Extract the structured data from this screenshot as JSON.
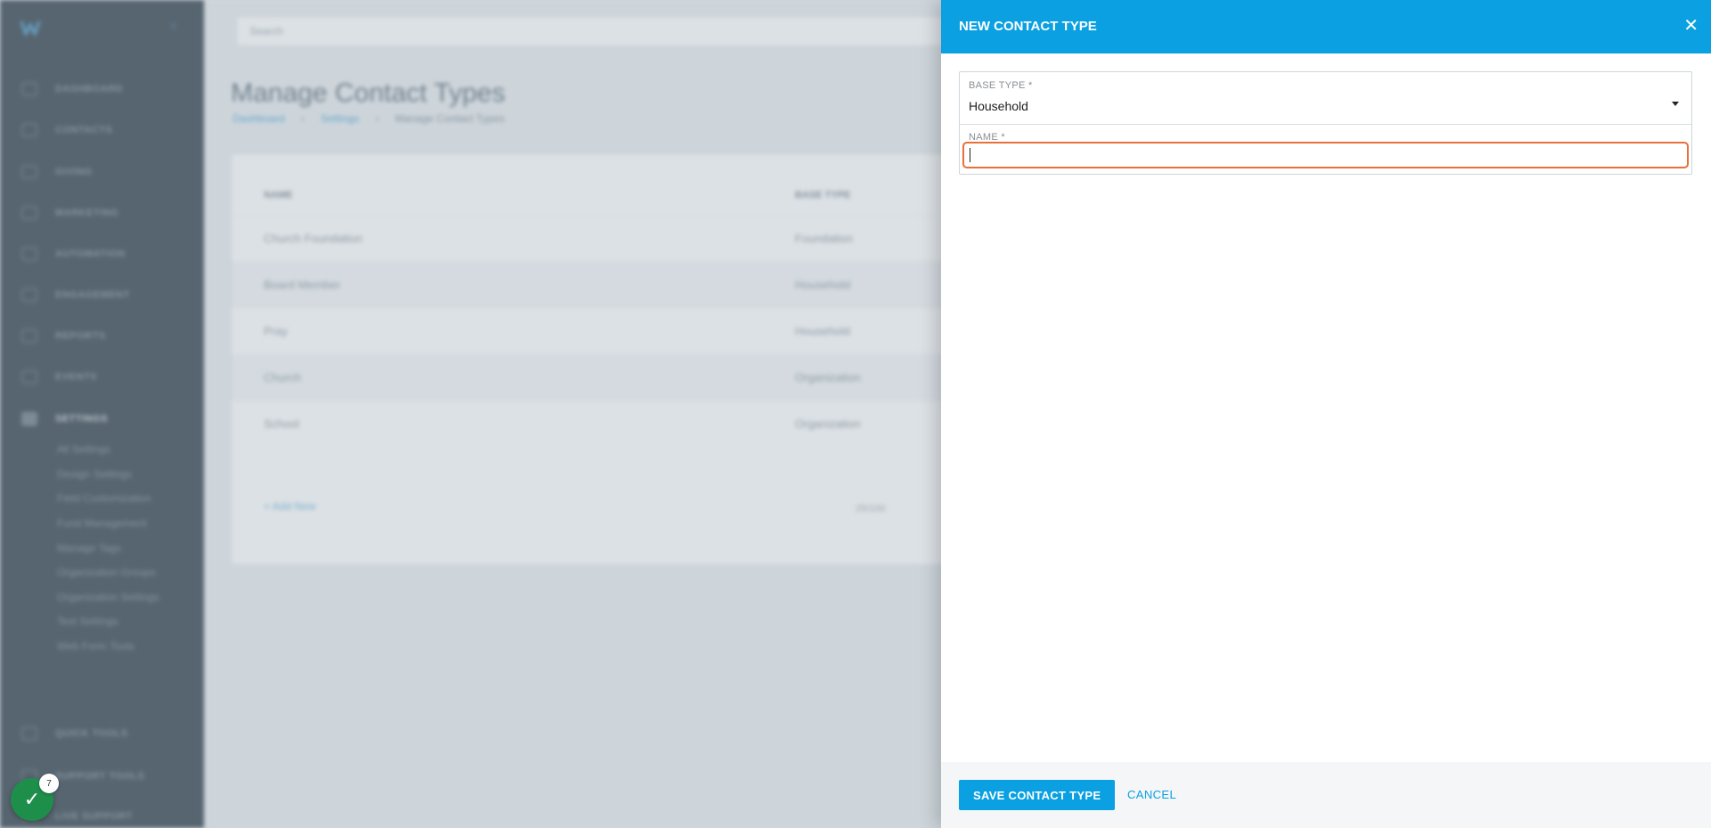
{
  "background": {
    "search_placeholder": "Search",
    "page_title": "Manage Contact Types",
    "breadcrumb": [
      "Dashboard",
      "Settings",
      "Manage Contact Types"
    ],
    "nav": [
      "DASHBOARD",
      "CONTACTS",
      "GIVING",
      "MARKETING",
      "AUTOMATION",
      "ENGAGEMENT",
      "REPORTS",
      "EVENTS",
      "SETTINGS"
    ],
    "settings_subitems": [
      "All Settings",
      "Design Settings",
      "Field Customization",
      "Fund Management",
      "Manage Tags",
      "Organization Groups",
      "Organization Settings",
      "Text Settings",
      "Web Form Tools"
    ],
    "bottom_nav": [
      "QUICK TOOLS",
      "SUPPORT TOOLS",
      "LIVE SUPPORT"
    ],
    "table": {
      "headers": [
        "NAME",
        "BASE TYPE"
      ],
      "rows": [
        [
          "Church Foundation",
          "Foundation"
        ],
        [
          "Board Member",
          "Household"
        ],
        [
          "Pray",
          "Household"
        ],
        [
          "Church",
          "Organization"
        ],
        [
          "School",
          "Organization"
        ]
      ]
    },
    "add_new": "+ Add New",
    "pager_text": "25/100"
  },
  "status": {
    "count": "7",
    "icon": "check-icon"
  },
  "drawer": {
    "title": "NEW CONTACT TYPE",
    "close_icon": "close-icon",
    "base_type_label": "BASE TYPE *",
    "base_type_value": "Household",
    "name_label": "NAME *",
    "name_value": "",
    "save_label": "SAVE CONTACT TYPE",
    "cancel_label": "CANCEL"
  },
  "colors": {
    "accent": "#0aa0e1",
    "focus_border": "#e8703a",
    "sidebar": "#33414c",
    "success": "#1e8f4a"
  }
}
